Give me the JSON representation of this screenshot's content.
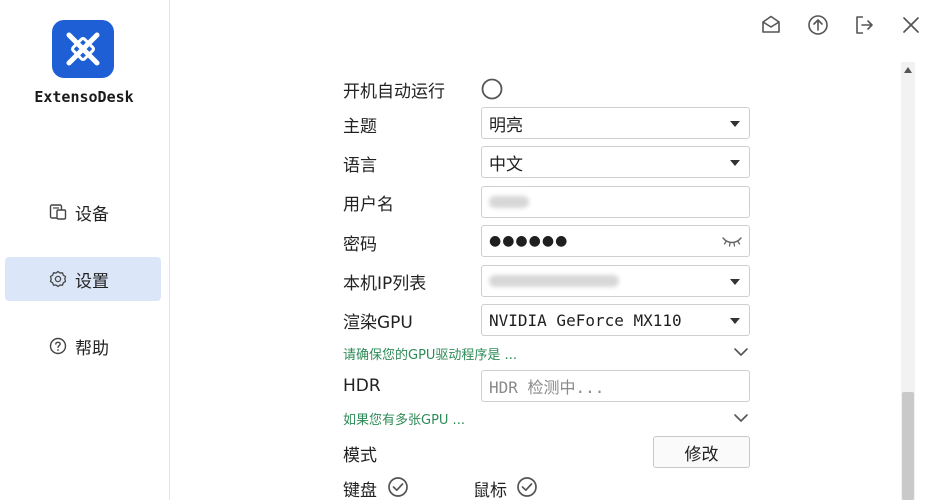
{
  "app": {
    "name": "ExtensoDesk"
  },
  "sidebar": {
    "items": [
      {
        "label": "设备",
        "icon": "device-icon"
      },
      {
        "label": "设置",
        "icon": "gear-icon",
        "active": true
      },
      {
        "label": "帮助",
        "icon": "help-icon"
      }
    ]
  },
  "topbar": {
    "icons": [
      "mail-icon",
      "upload-icon",
      "logout-icon",
      "close-icon"
    ]
  },
  "settings": {
    "autostart_label": "开机自动运行",
    "theme_label": "主题",
    "theme_value": "明亮",
    "language_label": "语言",
    "language_value": "中文",
    "username_label": "用户名",
    "password_label": "密码",
    "password_value": "●●●●●●",
    "ip_label": "本机IP列表",
    "gpu_label": "渲染GPU",
    "gpu_value": "NVIDIA GeForce MX110",
    "gpu_hint": "请确保您的GPU驱动程序是 ...",
    "hdr_label": "HDR",
    "hdr_placeholder": "HDR 检测中...",
    "multigpu_hint": "如果您有多张GPU ...",
    "mode_label": "模式",
    "modify_button": "修改",
    "keyboard_label": "键盘",
    "mouse_label": "鼠标"
  },
  "colors": {
    "accent": "#1e5fd6",
    "active_nav": "#dbe7f8",
    "hint": "#2e8b57"
  }
}
